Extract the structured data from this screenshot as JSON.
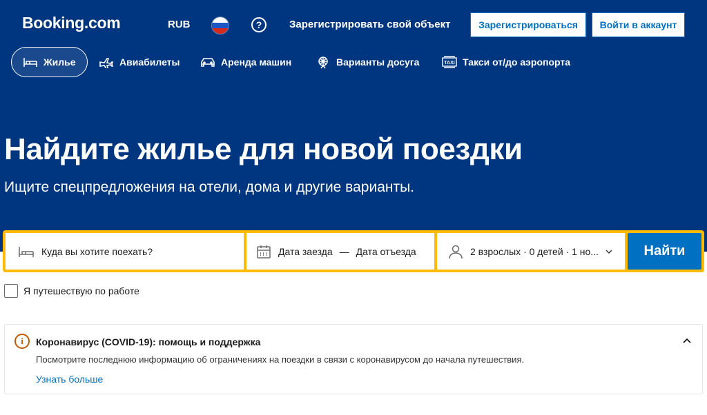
{
  "header": {
    "logo": "Booking.com",
    "currency": "RUB",
    "help": "?",
    "list_property": "Зарегистрировать свой объект",
    "register": "Зарегистрироваться",
    "sign_in": "Войти в аккаунт",
    "flag_icon": "russia-flag-icon"
  },
  "nav": {
    "items": [
      {
        "label": "Жилье",
        "icon": "bed-icon",
        "active": true
      },
      {
        "label": "Авиабилеты",
        "icon": "plane-icon"
      },
      {
        "label": "Аренда машин",
        "icon": "car-icon"
      },
      {
        "label": "Варианты досуга",
        "icon": "attractions-icon"
      },
      {
        "label": "Такси от/до аэропорта",
        "icon": "taxi-icon"
      }
    ]
  },
  "hero": {
    "title": "Найдите жилье для новой поездки",
    "subtitle": "Ищите спецпредложения на отели, дома и другие варианты."
  },
  "search": {
    "destination_placeholder": "Куда вы хотите поехать?",
    "checkin": "Дата заезда",
    "dash": "—",
    "checkout": "Дата отъезда",
    "guests": "2 взрослых · 0 детей · 1 но...",
    "button": "Найти"
  },
  "work_travel": {
    "label": "Я путешествую по работе",
    "checked": false
  },
  "covid": {
    "title": "Коронавирус (COVID-19): помощь и поддержка",
    "text": "Посмотрите последнюю информацию об ограничениях на поездки в связи с коронавирусом до начала путешествия.",
    "link": "Узнать больше",
    "icon": "i"
  },
  "colors": {
    "brand_blue": "#003580",
    "accent_blue": "#0071c2",
    "search_yellow": "#febb02",
    "warning_orange": "#c45a00"
  }
}
